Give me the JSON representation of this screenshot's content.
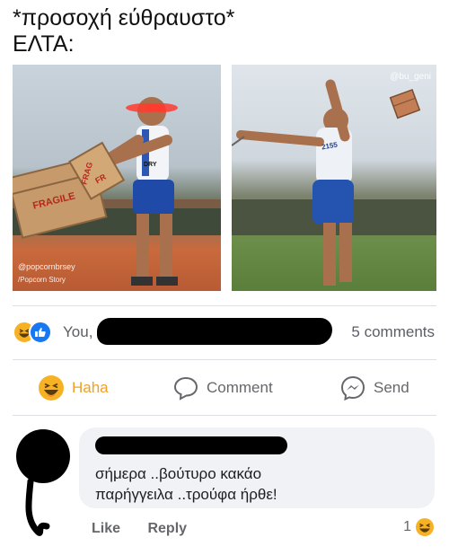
{
  "caption": {
    "line1": "*προσοχή εύθραυστο*",
    "line2": "ΕΛΤΑ:"
  },
  "photos": {
    "left": {
      "box_label_1": "FRAGILE",
      "box_label_2": "FRAG",
      "box_label_3": "FR",
      "bib": "DRY",
      "watermark_1": "@popcornbrsey",
      "watermark_2": "/Popcorn Story"
    },
    "right": {
      "bib": "2155",
      "watermark": "@bu_geni"
    }
  },
  "reactions": {
    "names_prefix": "You, ",
    "comments_count": "5 comments",
    "icons": [
      "haha-reaction-icon",
      "like-reaction-icon"
    ]
  },
  "actions": {
    "haha_label": "Haha",
    "comment_label": "Comment",
    "send_label": "Send"
  },
  "comment": {
    "text_line1": "σήμερα ..βούτυρο κακάο",
    "text_line2": "παρήγγειλα ..τρούφα ήρθε!",
    "like_label": "Like",
    "reply_label": "Reply",
    "reaction_count": "1"
  },
  "colors": {
    "like_blue": "#1877f2",
    "haha_yellow": "#f7b125",
    "secondary_text": "#65676b",
    "bubble_bg": "#f0f2f5"
  }
}
